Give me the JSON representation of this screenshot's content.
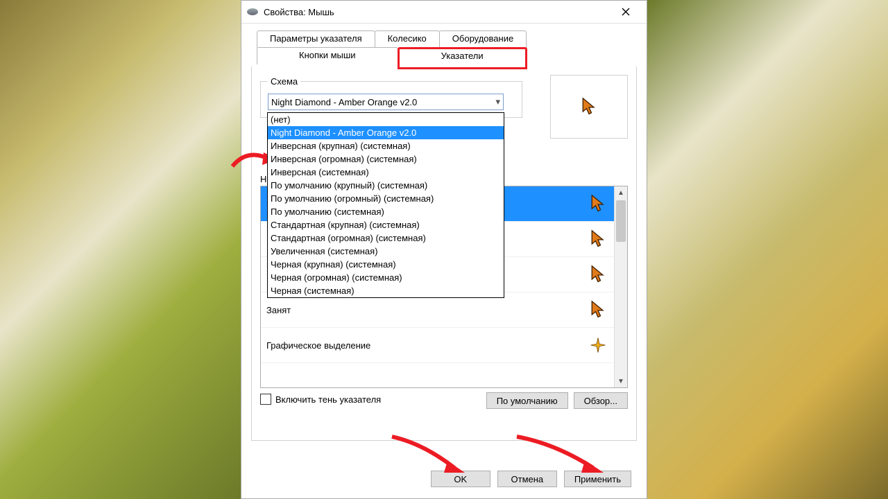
{
  "title": "Свойства: Мышь",
  "tabs_back": [
    "Параметры указателя",
    "Колесико",
    "Оборудование"
  ],
  "tabs_front": [
    "Кнопки мыши",
    "Указатели"
  ],
  "active_tab": "Указатели",
  "scheme": {
    "legend": "Схема",
    "selected": "Night Diamond - Amber Orange v2.0",
    "options": [
      "(нет)",
      "Night Diamond - Amber Orange v2.0",
      "Инверсная (крупная) (системная)",
      "Инверсная (огромная) (системная)",
      "Инверсная (системная)",
      "По умолчанию (крупный) (системная)",
      "По умолчанию (огромный) (системная)",
      "По умолчанию (системная)",
      "Стандартная (крупная) (системная)",
      "Стандартная (огромная) (системная)",
      "Увеличенная (системная)",
      "Черная (крупная) (системная)",
      "Черная (огромная) (системная)",
      "Черная (системная)"
    ],
    "selected_index": 1
  },
  "customize_legend": "Настройка",
  "cursor_rows": [
    {
      "label": "",
      "icon": "amber"
    },
    {
      "label": "",
      "icon": "amber"
    },
    {
      "label": "",
      "icon": "amber"
    },
    {
      "label": "Занят",
      "icon": "amber"
    },
    {
      "label": "Графическое выделение",
      "icon": "cross"
    }
  ],
  "cursor_selected_index": 0,
  "checkbox_label": "Включить тень указателя",
  "btn_default": "По умолчанию",
  "btn_browse": "Обзор...",
  "btn_ok": "OK",
  "btn_cancel": "Отмена",
  "btn_apply": "Применить"
}
